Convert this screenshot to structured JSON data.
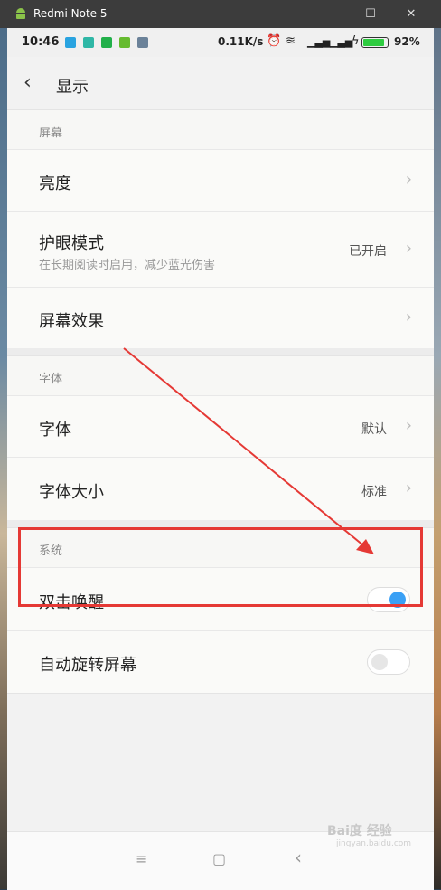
{
  "window": {
    "title": "Redmi Note 5",
    "minimize": "—",
    "maximize": "☐",
    "close": "✕"
  },
  "status": {
    "time": "10:46",
    "speed": "0.11K/s",
    "battery_pct": "92%",
    "battery_level": 0.92
  },
  "header": {
    "back": "‹",
    "title": "显示"
  },
  "sections": {
    "screen": "屏幕",
    "font": "字体",
    "system": "系统"
  },
  "rows": {
    "brightness": {
      "label": "亮度"
    },
    "eye_mode": {
      "label": "护眼模式",
      "sub": "在长期阅读时启用，减少蓝光伤害",
      "value": "已开启"
    },
    "screen_effect": {
      "label": "屏幕效果"
    },
    "font": {
      "label": "字体",
      "value": "默认"
    },
    "font_size": {
      "label": "字体大小",
      "value": "标准"
    },
    "double_tap": {
      "label": "双击唤醒",
      "on": true
    },
    "auto_rotate": {
      "label": "自动旋转屏幕",
      "on": false
    }
  },
  "chevron": "›",
  "nav": {
    "menu": "≡",
    "home": "▢",
    "back": "‹"
  },
  "watermark": {
    "main": "Bai度 经验",
    "sub": "jingyan.baidu.com"
  },
  "colors": {
    "accent": "#3aa0f5",
    "highlight": "#e53935"
  }
}
